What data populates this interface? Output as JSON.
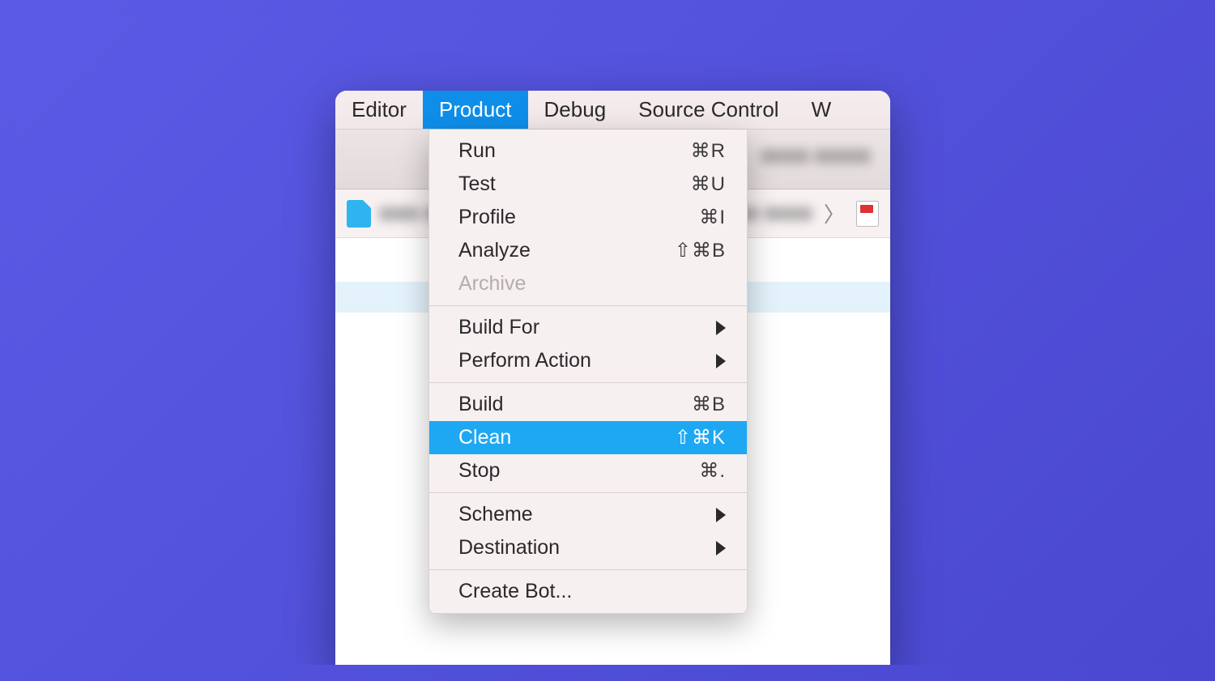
{
  "menubar": {
    "items": [
      {
        "label": "Editor",
        "active": false
      },
      {
        "label": "Product",
        "active": true
      },
      {
        "label": "Debug",
        "active": false
      },
      {
        "label": "Source Control",
        "active": false
      },
      {
        "label": "W",
        "active": false
      }
    ]
  },
  "dropdown": {
    "sections": [
      [
        {
          "label": "Run",
          "shortcut": "⌘R"
        },
        {
          "label": "Test",
          "shortcut": "⌘U"
        },
        {
          "label": "Profile",
          "shortcut": "⌘I"
        },
        {
          "label": "Analyze",
          "shortcut": "⇧⌘B"
        },
        {
          "label": "Archive",
          "disabled": true
        }
      ],
      [
        {
          "label": "Build For",
          "submenu": true
        },
        {
          "label": "Perform Action",
          "submenu": true
        }
      ],
      [
        {
          "label": "Build",
          "shortcut": "⌘B"
        },
        {
          "label": "Clean",
          "shortcut": "⇧⌘K",
          "highlight": true
        },
        {
          "label": "Stop",
          "shortcut": "⌘."
        }
      ],
      [
        {
          "label": "Scheme",
          "submenu": true
        },
        {
          "label": "Destination",
          "submenu": true
        }
      ],
      [
        {
          "label": "Create Bot..."
        }
      ]
    ]
  }
}
